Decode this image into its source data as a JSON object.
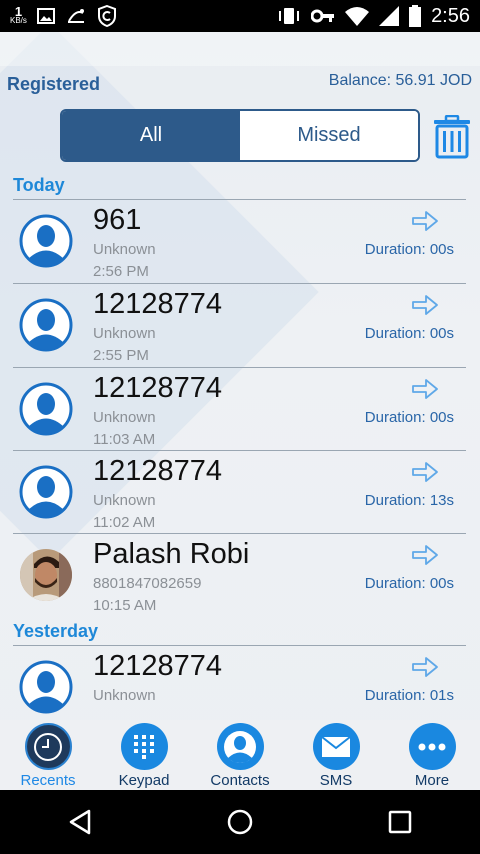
{
  "status_bar": {
    "speed_value": "1",
    "speed_unit": "KB/s",
    "time": "2:56",
    "icons": [
      "image-icon",
      "teletalk-icon",
      "shield-icon",
      "vibrate-icon",
      "vpn-key-icon",
      "wifi-icon",
      "signal-icon",
      "battery-icon"
    ]
  },
  "header": {
    "registration": "Registered",
    "balance": "Balance: 56.91 JOD"
  },
  "filter": {
    "tabs": [
      {
        "label": "All",
        "active": true
      },
      {
        "label": "Missed",
        "active": false
      }
    ],
    "delete_icon": "trash-icon"
  },
  "sections": [
    {
      "title": "Today",
      "calls": [
        {
          "name": "961",
          "sub": "Unknown",
          "time": "2:56 PM",
          "duration": "Duration: 00s",
          "avatar": "default-avatar"
        },
        {
          "name": "12128774",
          "sub": "Unknown",
          "time": "2:55 PM",
          "duration": "Duration: 00s",
          "avatar": "default-avatar"
        },
        {
          "name": "12128774",
          "sub": "Unknown",
          "time": "11:03 AM",
          "duration": "Duration: 00s",
          "avatar": "default-avatar"
        },
        {
          "name": "12128774",
          "sub": "Unknown",
          "time": "11:02 AM",
          "duration": "Duration: 13s",
          "avatar": "default-avatar"
        },
        {
          "name": "Palash Robi",
          "sub": "8801847082659",
          "time": "10:15 AM",
          "duration": "Duration: 00s",
          "avatar": "contact-photo"
        }
      ]
    },
    {
      "title": "Yesterday",
      "calls": [
        {
          "name": "12128774",
          "sub": "Unknown",
          "time": "",
          "duration": "Duration: 01s",
          "avatar": "default-avatar"
        }
      ]
    }
  ],
  "tab_bar": [
    {
      "label": "Recents",
      "icon": "clock-icon",
      "active": true
    },
    {
      "label": "Keypad",
      "icon": "keypad-icon",
      "active": false
    },
    {
      "label": "Contacts",
      "icon": "contact-icon",
      "active": false
    },
    {
      "label": "SMS",
      "icon": "envelope-icon",
      "active": false
    },
    {
      "label": "More",
      "icon": "more-icon",
      "active": false
    }
  ],
  "nav_bar": [
    "back-icon",
    "home-icon",
    "recents-icon"
  ],
  "colors": {
    "accent": "#1e88e5",
    "primary": "#2d5a8a",
    "text_secondary": "#8b9096"
  }
}
